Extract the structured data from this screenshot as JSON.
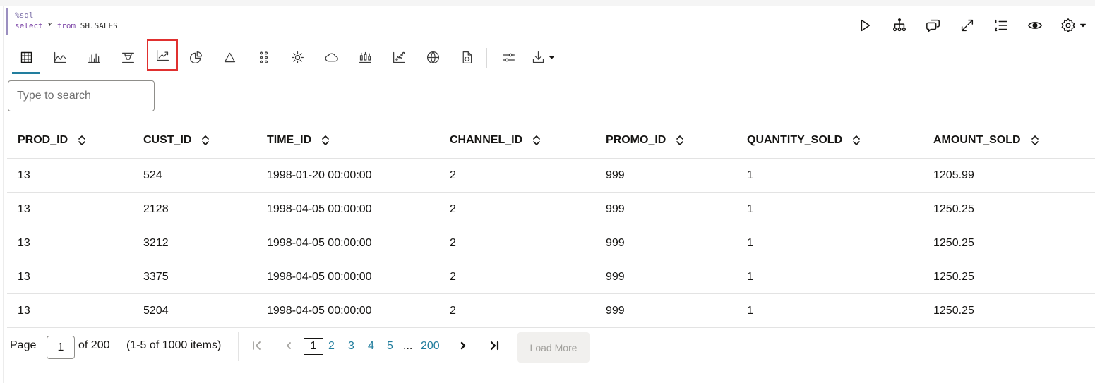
{
  "editor": {
    "line1": "%sql",
    "line2_keyword1": "select",
    "line2_star": " * ",
    "line2_keyword2": "from",
    "line2_table": " SH.SALES"
  },
  "actions": {
    "icons": [
      "run-icon",
      "explain-plan-icon",
      "comments-icon",
      "expand-icon",
      "line-numbers-icon",
      "visibility-icon",
      "settings-icon",
      "caret-down-icon"
    ]
  },
  "viz_toolbar": {
    "icons": [
      "table-icon",
      "area-chart-icon",
      "bar-chart-icon",
      "funnel-chart-icon",
      "line-chart-icon",
      "pie-chart-icon",
      "pyramid-icon",
      "scatter-grid-icon",
      "sunburst-icon",
      "tag-cloud-icon",
      "boxplot-icon",
      "scatter-plot-icon",
      "map-icon",
      "code-file-icon",
      "settings-sliders-icon",
      "download-icon"
    ],
    "highlight_color": "#e0302f",
    "active_color": "#227e9e"
  },
  "search": {
    "placeholder": "Type to search",
    "value": ""
  },
  "table": {
    "columns": [
      "PROD_ID",
      "CUST_ID",
      "TIME_ID",
      "CHANNEL_ID",
      "PROMO_ID",
      "QUANTITY_SOLD",
      "AMOUNT_SOLD"
    ],
    "rows": [
      [
        "13",
        "524",
        "1998-01-20 00:00:00",
        "2",
        "999",
        "1",
        "1205.99"
      ],
      [
        "13",
        "2128",
        "1998-04-05 00:00:00",
        "2",
        "999",
        "1",
        "1250.25"
      ],
      [
        "13",
        "3212",
        "1998-04-05 00:00:00",
        "2",
        "999",
        "1",
        "1250.25"
      ],
      [
        "13",
        "3375",
        "1998-04-05 00:00:00",
        "2",
        "999",
        "1",
        "1250.25"
      ],
      [
        "13",
        "5204",
        "1998-04-05 00:00:00",
        "2",
        "999",
        "1",
        "1250.25"
      ]
    ]
  },
  "pagination": {
    "page_label": "Page",
    "current_page": "1",
    "of_label": "of 200",
    "items_label": "(1-5 of 1000 items)",
    "pages": [
      "1",
      "2",
      "3",
      "4",
      "5"
    ],
    "ellipsis": "...",
    "last_page": "200",
    "load_more": "Load More"
  }
}
